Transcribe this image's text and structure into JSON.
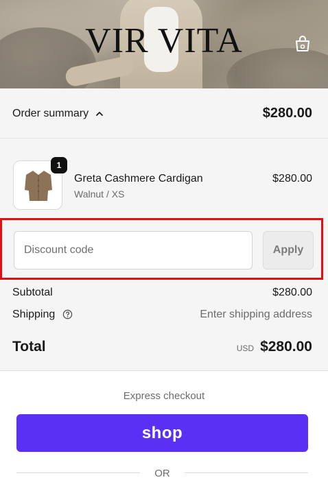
{
  "header": {
    "brand": "VIR VITA",
    "cart_icon": "shopping-bag-icon"
  },
  "summary": {
    "toggle_label": "Order summary",
    "toggle_icon": "chevron-up-icon",
    "total": "$280.00"
  },
  "line_item": {
    "quantity": "1",
    "name": "Greta Cashmere Cardigan",
    "variant": "Walnut / XS",
    "price": "$280.00"
  },
  "discount": {
    "placeholder": "Discount code",
    "apply_label": "Apply",
    "highlight_color": "#e01010"
  },
  "totals": {
    "subtotal_label": "Subtotal",
    "subtotal_value": "$280.00",
    "shipping_label": "Shipping",
    "shipping_value": "Enter shipping address",
    "total_label": "Total",
    "currency": "USD",
    "total_value": "$280.00"
  },
  "express": {
    "label": "Express checkout",
    "shop_label": "shop",
    "shop_color": "#5a31f4",
    "or_label": "OR"
  }
}
